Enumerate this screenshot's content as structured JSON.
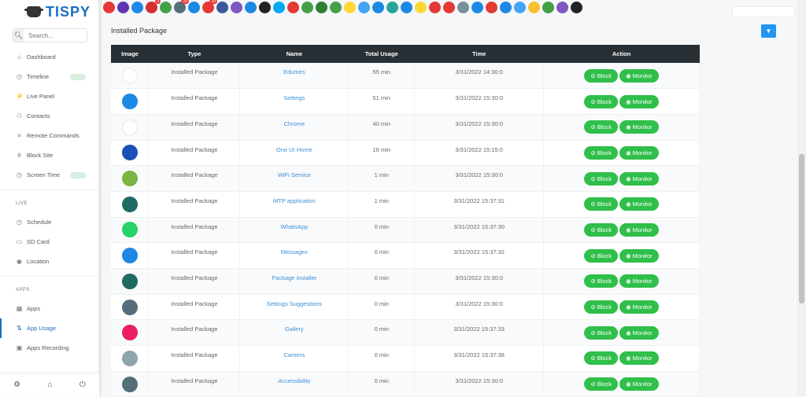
{
  "app": {
    "name": "TISPY"
  },
  "search": {
    "placeholder": "Search..."
  },
  "sidebar": {
    "main_items": [
      {
        "label": "Dashboard",
        "icon": "home-icon"
      },
      {
        "label": "Timeline",
        "icon": "clock-icon",
        "badge": true
      },
      {
        "label": "Live Panel",
        "icon": "bolt-icon"
      },
      {
        "label": "Contacts",
        "icon": "users-icon"
      },
      {
        "label": "Remote Commands",
        "icon": "sliders-icon"
      },
      {
        "label": "Block Site",
        "icon": "hash-icon"
      },
      {
        "label": "Screen Time",
        "icon": "clock-icon",
        "badge": true
      }
    ],
    "live_label": "LIVE",
    "live_items": [
      {
        "label": "Schedule",
        "icon": "clock-icon"
      },
      {
        "label": "SD Card",
        "icon": "card-icon"
      },
      {
        "label": "Location",
        "icon": "pin-icon"
      }
    ],
    "apps_label": "APPS",
    "apps_items": [
      {
        "label": "Apps",
        "icon": "grid-icon"
      },
      {
        "label": "App Usage",
        "icon": "sort-icon",
        "active": true
      },
      {
        "label": "Apps Recording",
        "icon": "record-icon"
      }
    ]
  },
  "top_icons": [
    {
      "name": "video-call-icon",
      "color": "#e53935"
    },
    {
      "name": "phone-icon",
      "color": "#5e35b1"
    },
    {
      "name": "chat-icon",
      "color": "#1e88e5"
    },
    {
      "name": "message-icon",
      "color": "#d32f2f",
      "count": "3"
    },
    {
      "name": "whatsapp-icon",
      "color": "#43a047"
    },
    {
      "name": "sms-icon",
      "color": "#546e7a",
      "count": "20"
    },
    {
      "name": "device-icon",
      "color": "#1e88e5"
    },
    {
      "name": "web-icon",
      "color": "#e53935",
      "count": "20"
    },
    {
      "name": "facebook-icon",
      "color": "#3b5998"
    },
    {
      "name": "viber-icon",
      "color": "#7e57c2"
    },
    {
      "name": "signal-icon",
      "color": "#1e88e5"
    },
    {
      "name": "kik-icon",
      "color": "#222222"
    },
    {
      "name": "skype-icon",
      "color": "#03a9f4"
    },
    {
      "name": "tinder-icon",
      "color": "#e53935"
    },
    {
      "name": "wechat-icon",
      "color": "#43a047"
    },
    {
      "name": "hangouts-icon",
      "color": "#2e7d32"
    },
    {
      "name": "line-icon",
      "color": "#43a047"
    },
    {
      "name": "snapchat-icon",
      "color": "#fdd835"
    },
    {
      "name": "mail-icon",
      "color": "#42a5f5"
    },
    {
      "name": "imo-icon",
      "color": "#1e88e5"
    },
    {
      "name": "hike-icon",
      "color": "#26a69a"
    },
    {
      "name": "duo-icon",
      "color": "#1e88e5"
    },
    {
      "name": "bubbles-icon",
      "color": "#fdd835"
    },
    {
      "name": "kakao-icon",
      "color": "#e53935"
    },
    {
      "name": "lovoo-icon",
      "color": "#e53935"
    },
    {
      "name": "tiktok-icon",
      "color": "#78909c"
    },
    {
      "name": "vk-icon",
      "color": "#1e88e5"
    },
    {
      "name": "youtube-icon",
      "color": "#e53935"
    },
    {
      "name": "telegram-icon",
      "color": "#1e88e5"
    },
    {
      "name": "messenger-icon",
      "color": "#42a5f5"
    },
    {
      "name": "notes-icon",
      "color": "#fbc02d"
    },
    {
      "name": "download-icon",
      "color": "#43a047"
    },
    {
      "name": "badoo-icon",
      "color": "#7e57c2"
    },
    {
      "name": "help-icon",
      "color": "#222222"
    }
  ],
  "page": {
    "title": "Installed Package"
  },
  "table": {
    "headers": [
      "Image",
      "Type",
      "Name",
      "Total Usage",
      "Time",
      "Action"
    ],
    "block_label": "Block",
    "monitor_label": "Monitor",
    "rows": [
      {
        "icon": "edumes-icon",
        "icon_color": "#ffffff",
        "type": "Installed Package",
        "name": "Edumes",
        "usage": "55 min",
        "time": "3/31/2022 14:30:0"
      },
      {
        "icon": "settings-icon",
        "icon_color": "#1e88e5",
        "type": "Installed Package",
        "name": "Settings",
        "usage": "51 min",
        "time": "3/31/2022 15:30:0"
      },
      {
        "icon": "chrome-icon",
        "icon_color": "#ffffff",
        "type": "Installed Package",
        "name": "Chrome",
        "usage": "40 min",
        "time": "3/31/2022 15:30:0"
      },
      {
        "icon": "oneui-home-icon",
        "icon_color": "#1a4fb8",
        "type": "Installed Package",
        "name": "One UI Home",
        "usage": "16 min",
        "time": "3/31/2022 15:15:0"
      },
      {
        "icon": "android-icon",
        "icon_color": "#7cb342",
        "type": "Installed Package",
        "name": "WiFi Service",
        "usage": "1 min",
        "time": "3/31/2022 15:30:0"
      },
      {
        "icon": "android-dark-icon",
        "icon_color": "#1f6b63",
        "type": "Installed Package",
        "name": "MTP application",
        "usage": "1 min",
        "time": "3/31/2022 15:37:31"
      },
      {
        "icon": "whatsapp-icon",
        "icon_color": "#25d366",
        "type": "Installed Package",
        "name": "WhatsApp",
        "usage": "0 min",
        "time": "3/31/2022 15:37:30"
      },
      {
        "icon": "messages-icon",
        "icon_color": "#1e88e5",
        "type": "Installed Package",
        "name": "Messages",
        "usage": "0 min",
        "time": "3/31/2022 15:37:32"
      },
      {
        "icon": "android-dark-icon",
        "icon_color": "#1f6b63",
        "type": "Installed Package",
        "name": "Package installer",
        "usage": "0 min",
        "time": "3/31/2022 15:30:0"
      },
      {
        "icon": "gear-icon",
        "icon_color": "#546e7a",
        "type": "Installed Package",
        "name": "Settings Suggestions",
        "usage": "0 min",
        "time": "3/31/2022 15:30:0"
      },
      {
        "icon": "gallery-icon",
        "icon_color": "#e91e63",
        "type": "Installed Package",
        "name": "Gallery",
        "usage": "0 min",
        "time": "3/31/2022 15:37:33"
      },
      {
        "icon": "camera-icon",
        "icon_color": "#90a4ae",
        "type": "Installed Package",
        "name": "Camera",
        "usage": "0 min",
        "time": "3/31/2022 15:37:38"
      },
      {
        "icon": "gear-icon",
        "icon_color": "#546e7a",
        "type": "Installed Package",
        "name": "Accessibility",
        "usage": "0 min",
        "time": "3/31/2022 15:30:0"
      }
    ]
  }
}
